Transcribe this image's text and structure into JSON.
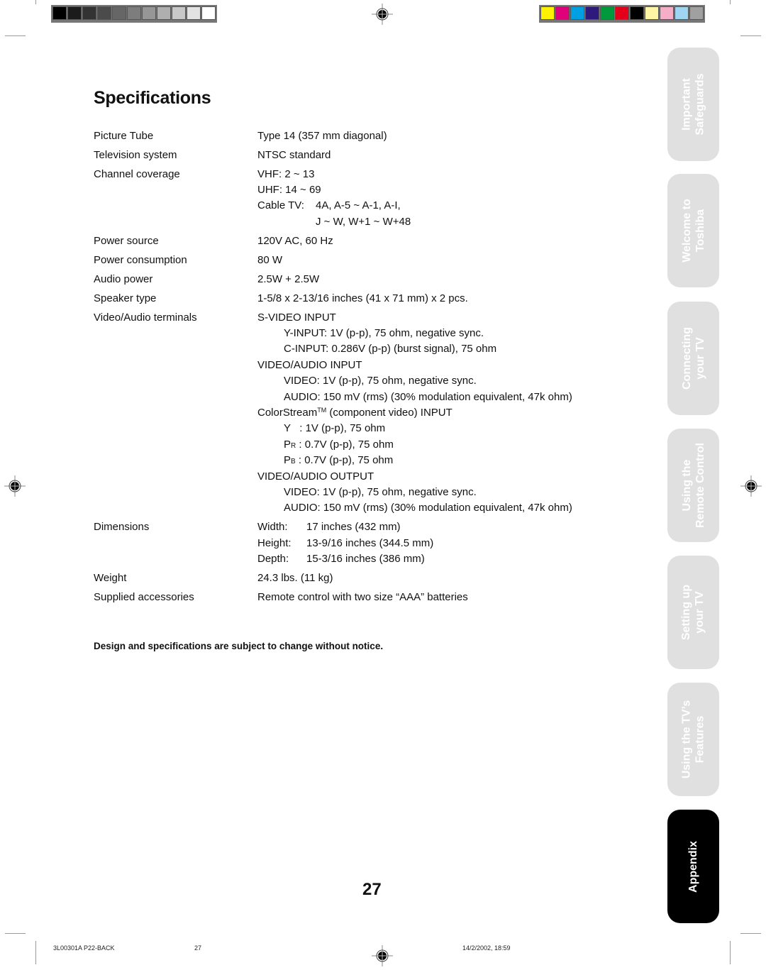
{
  "grayscale_bar": [
    "#000000",
    "#1b1b1b",
    "#333333",
    "#4b4b4b",
    "#666666",
    "#7d7d7d",
    "#969696",
    "#afafaf",
    "#c8c8c8",
    "#e3e3e3",
    "#ffffff"
  ],
  "color_bar": [
    "#fff200",
    "#e0007a",
    "#00a0e3",
    "#2e1a7c",
    "#009a3d",
    "#e2001a",
    "#000000",
    "#fff6a5",
    "#f5aec8",
    "#9fd4f3",
    "#a0a0a0"
  ],
  "title": "Specifications",
  "specs": {
    "picture_tube": {
      "label": "Picture Tube",
      "value": "Type 14 (357 mm diagonal)"
    },
    "tv_system": {
      "label": "Television system",
      "value": "NTSC standard"
    },
    "channel": {
      "label": "Channel coverage",
      "vhf": "VHF: 2 ~ 13",
      "uhf": "UHF: 14 ~ 69",
      "cable_key": "Cable TV:",
      "cable_1": "4A, A-5 ~ A-1, A-I,",
      "cable_2": "J ~ W, W+1 ~ W+48"
    },
    "power_source": {
      "label": "Power source",
      "value": "120V AC, 60 Hz"
    },
    "power_consumption": {
      "label": "Power consumption",
      "value": "80 W"
    },
    "audio_power": {
      "label": "Audio power",
      "value": "2.5W + 2.5W"
    },
    "speaker": {
      "label": "Speaker type",
      "value": "1-5/8 x 2-13/16 inches (41 x 71 mm) x 2 pcs."
    },
    "terminals": {
      "label": "Video/Audio terminals",
      "svideo_head": "S-VIDEO INPUT",
      "svideo_y": "Y-INPUT: 1V (p-p), 75 ohm, negative sync.",
      "svideo_c": "C-INPUT: 0.286V (p-p) (burst signal), 75 ohm",
      "va_in_head": "VIDEO/AUDIO INPUT",
      "va_in_video": "VIDEO: 1V (p-p), 75 ohm, negative sync.",
      "va_in_audio": "AUDIO: 150 mV (rms) (30% modulation equivalent, 47k ohm)",
      "cs_head_a": "ColorStream",
      "cs_tm": "TM",
      "cs_head_b": " (component video) INPUT",
      "cs_y": "Y   : 1V (p-p), 75 ohm",
      "cs_pr_p": "P",
      "cs_pr_sub": "R",
      "cs_pr": " : 0.7V (p-p), 75 ohm",
      "cs_pb_p": "P",
      "cs_pb_sub": "B",
      "cs_pb": " : 0.7V (p-p), 75 ohm",
      "va_out_head": "VIDEO/AUDIO OUTPUT",
      "va_out_video": "VIDEO: 1V (p-p), 75 ohm, negative sync.",
      "va_out_audio": "AUDIO: 150 mV (rms) (30% modulation equivalent, 47k ohm)"
    },
    "dimensions": {
      "label": "Dimensions",
      "width_key": "Width:",
      "width": "17 inches (432 mm)",
      "height_key": "Height:",
      "height": "13-9/16 inches (344.5 mm)",
      "depth_key": "Depth:",
      "depth": "15-3/16 inches (386 mm)"
    },
    "weight": {
      "label": "Weight",
      "value": "24.3 lbs. (11 kg)"
    },
    "accessories": {
      "label": "Supplied accessories",
      "value": "Remote control with two size “AAA” batteries"
    }
  },
  "notice": "Design and specifications are subject to change without notice.",
  "page_number": "27",
  "side_tabs": [
    {
      "line1": "Important",
      "line2": "Safeguards",
      "active": false
    },
    {
      "line1": "Welcome to",
      "line2": "Toshiba",
      "active": false
    },
    {
      "line1": "Connecting",
      "line2": "your TV",
      "active": false
    },
    {
      "line1": "Using the",
      "line2": "Remote Control",
      "active": false
    },
    {
      "line1": "Setting up",
      "line2": "your TV",
      "active": false
    },
    {
      "line1": "Using the TV’s",
      "line2": "Features",
      "active": false
    },
    {
      "line1": "Appendix",
      "line2": "",
      "active": true
    }
  ],
  "footer": {
    "job": "3L00301A P22-BACK",
    "page": "27",
    "datetime": "14/2/2002, 18:59"
  }
}
